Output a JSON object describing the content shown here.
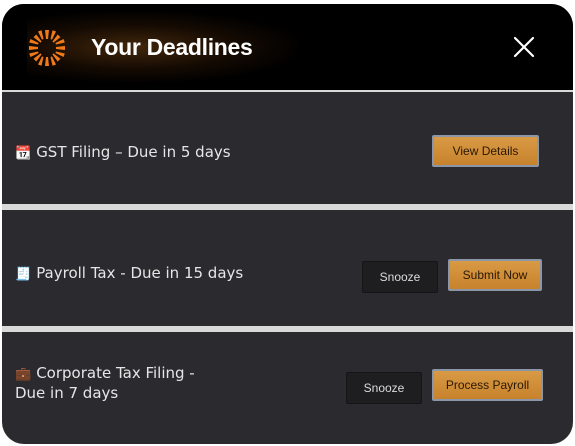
{
  "header": {
    "title": "Your Deadlines",
    "logo_icon": "sunburst-logo-icon",
    "close_icon": "close-x-icon"
  },
  "deadlines": [
    {
      "icon": "📆",
      "text": "GST Filing – Due in 5 days",
      "primary_label": "View Details"
    },
    {
      "icon": "🧾",
      "text": "Payroll Tax - Due in 15 days",
      "secondary_label": "Snooze",
      "primary_label": "Submit Now"
    },
    {
      "icon": "💼",
      "text_line1": "Corporate Tax Filing -",
      "text_line2": "Due in 7 days",
      "secondary_label": "Snooze",
      "primary_label": "Process Payroll"
    }
  ],
  "colors": {
    "panel_bg": "#2b2a2e",
    "header_bg": "#000000",
    "accent": "#f07a1a",
    "button_primary": "#d08b38",
    "separator": "#d9d9d9"
  }
}
